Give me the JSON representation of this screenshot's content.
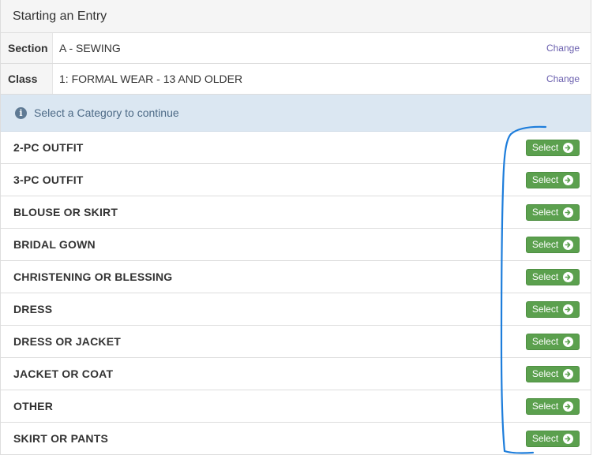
{
  "header": {
    "title": "Starting an Entry"
  },
  "info": [
    {
      "label": "Section",
      "value": "A - SEWING",
      "action": "Change"
    },
    {
      "label": "Class",
      "value": "1: FORMAL WEAR - 13 AND OLDER",
      "action": "Change"
    }
  ],
  "alert": {
    "text": "Select a Category to continue",
    "icon": "info-circle-icon"
  },
  "categories": [
    {
      "name": "2-PC OUTFIT",
      "button": "Select"
    },
    {
      "name": "3-PC OUTFIT",
      "button": "Select"
    },
    {
      "name": "BLOUSE OR SKIRT",
      "button": "Select"
    },
    {
      "name": "BRIDAL GOWN",
      "button": "Select"
    },
    {
      "name": "CHRISTENING OR BLESSING",
      "button": "Select"
    },
    {
      "name": "DRESS",
      "button": "Select"
    },
    {
      "name": "DRESS OR JACKET",
      "button": "Select"
    },
    {
      "name": "JACKET OR COAT",
      "button": "Select"
    },
    {
      "name": "OTHER",
      "button": "Select"
    },
    {
      "name": "SKIRT OR PANTS",
      "button": "Select"
    }
  ],
  "colors": {
    "select_button": "#5ba04e",
    "annotation_stroke": "#1d7ddb",
    "alert_bg": "#dbe7f2"
  }
}
